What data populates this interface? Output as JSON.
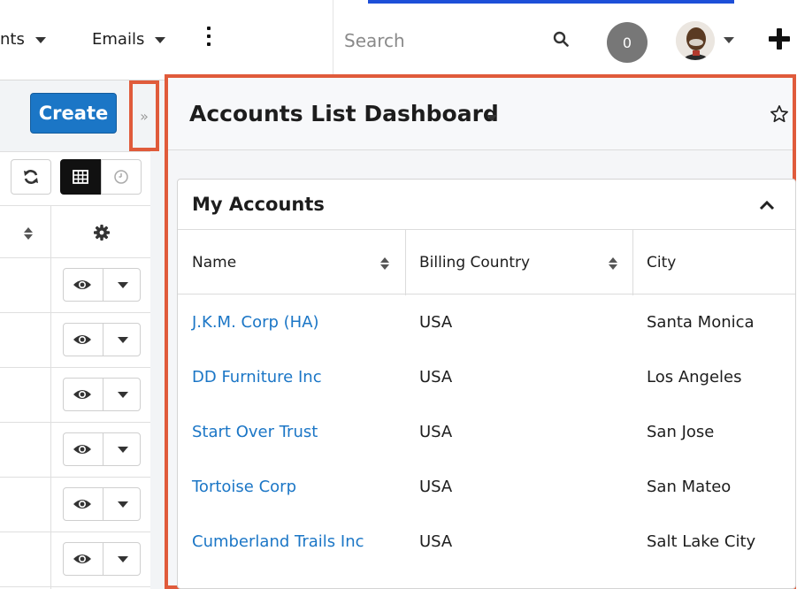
{
  "topnav": {
    "modules": [
      {
        "label": "nts"
      },
      {
        "label": "Emails"
      }
    ],
    "search_placeholder": "Search",
    "notifications_count": "0"
  },
  "sidebar_list": {
    "create_label": "Create",
    "toggle_label": "»",
    "row_count": 6
  },
  "dashboard": {
    "title": "Accounts List Dashboard",
    "dashlet": {
      "title": "My Accounts",
      "columns": [
        "Name",
        "Billing Country",
        "City"
      ],
      "rows": [
        {
          "name": "J.K.M. Corp (HA)",
          "country": "USA",
          "city": "Santa Monica"
        },
        {
          "name": "DD Furniture Inc",
          "country": "USA",
          "city": "Los Angeles"
        },
        {
          "name": "Start Over Trust",
          "country": "USA",
          "city": "San Jose"
        },
        {
          "name": "Tortoise Corp",
          "country": "USA",
          "city": "San Mateo"
        },
        {
          "name": "Cumberland Trails Inc",
          "country": "USA",
          "city": "Salt Lake City"
        }
      ]
    }
  },
  "colors": {
    "accent": "#1b76c6",
    "highlight": "#e05b3b"
  }
}
